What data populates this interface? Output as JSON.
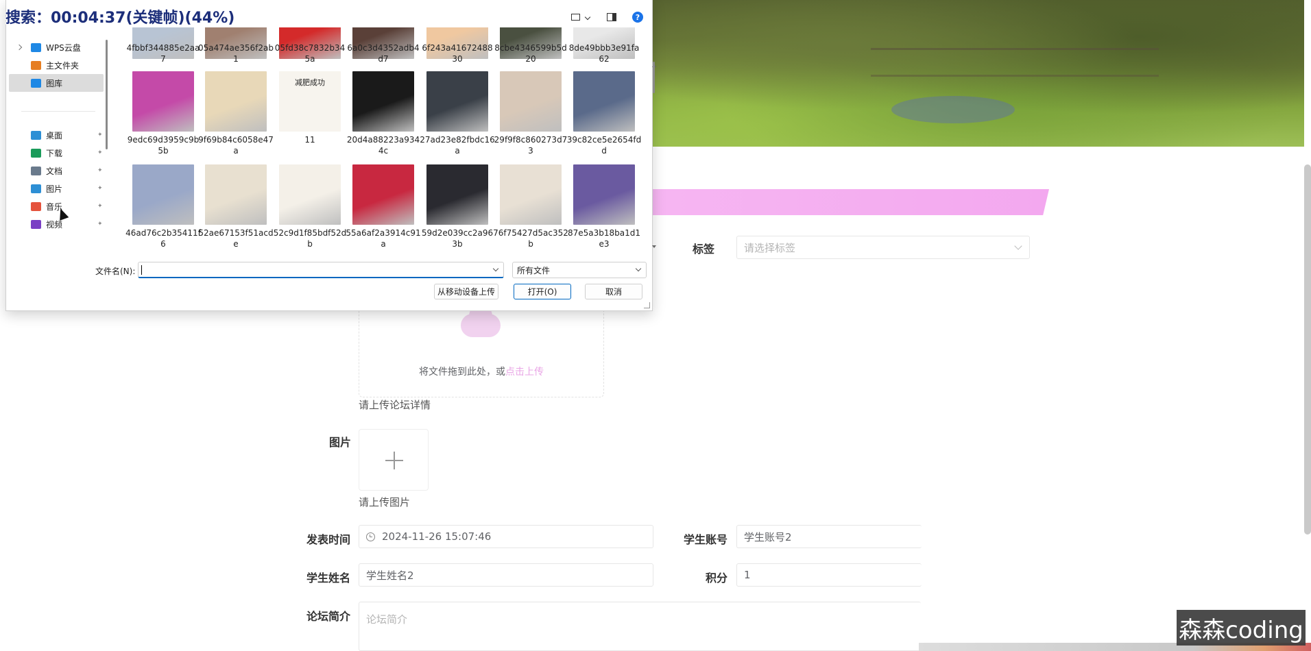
{
  "overlay": {
    "status_text": "搜索：00:04:37(关键帧)(44%)"
  },
  "form": {
    "tag_label": "标签",
    "tag_placeholder": "请选择标签",
    "upload_text": "将文件拖到此处，或",
    "upload_link": "点击上传",
    "detail_hint": "请上传论坛详情",
    "image_label": "图片",
    "image_hint": "请上传图片",
    "publish_time_label": "发表时间",
    "publish_time_value": "2024-11-26 15:07:46",
    "student_account_label": "学生账号",
    "student_account_value": "学生账号2",
    "student_name_label": "学生姓名",
    "student_name_value": "学生姓名2",
    "points_label": "积分",
    "points_value": "1",
    "intro_label": "论坛简介",
    "intro_placeholder": "论坛简介"
  },
  "watermark": {
    "text": "森森coding"
  },
  "dialog": {
    "toolbar": {
      "help_glyph": "?"
    },
    "nav": {
      "items": [
        {
          "label": "WPS云盘",
          "icon": "cloud-icon",
          "color": "#1e88e5"
        },
        {
          "label": "主文件夹",
          "icon": "home-icon",
          "color": "#e67e22"
        },
        {
          "label": "图库",
          "icon": "gallery-icon",
          "color": "#1e88e5"
        },
        {
          "label": "桌面",
          "icon": "desktop-icon",
          "color": "#2d8fd5"
        },
        {
          "label": "下载",
          "icon": "download-icon",
          "color": "#1a9b5a"
        },
        {
          "label": "文档",
          "icon": "documents-icon",
          "color": "#6a7a8c"
        },
        {
          "label": "图片",
          "icon": "pictures-icon",
          "color": "#2d8fd5"
        },
        {
          "label": "音乐",
          "icon": "music-icon",
          "color": "#e5533d"
        },
        {
          "label": "视频",
          "icon": "video-icon",
          "color": "#7a3fc4"
        }
      ]
    },
    "files": [
      {
        "name": "4fbbf344885e2aa7",
        "color": "#b8c4d4"
      },
      {
        "name": "05a474ae356f2ab1",
        "color": "#a08070"
      },
      {
        "name": "05fd38c7832b345a",
        "color": "#d42a2a"
      },
      {
        "name": "6a0c3d4352adb4d7",
        "color": "#5a4038"
      },
      {
        "name": "6f243a4167248830",
        "color": "#f0c8a0"
      },
      {
        "name": "8cbe4346599b5d20",
        "color": "#4a5040"
      },
      {
        "name": "8de49bbb3e91fa62",
        "color": "#e8e8e8"
      },
      {
        "name": "9edc69d3959c9b5b",
        "color": "#c44aa8"
      },
      {
        "name": "9f69b84c6058e47a",
        "color": "#e8d8b8"
      },
      {
        "name": "11",
        "color": "#3a3a3a"
      },
      {
        "name": "20d4a88223a9344c",
        "color": "#1a1a1a"
      },
      {
        "name": "27ad23e82fbdc16a",
        "color": "#3a4048"
      },
      {
        "name": "29f9f8c860273d73",
        "color": "#d8c8b8"
      },
      {
        "name": "39c82ce5e2654fdd",
        "color": "#5a6a8a"
      },
      {
        "name": "46ad76c2b35411f6",
        "color": "#9aa8c8"
      },
      {
        "name": "52ae67153f51acde",
        "color": "#e8e0d0"
      },
      {
        "name": "52c9d1f85bdf52db",
        "color": "#f4f0e8"
      },
      {
        "name": "55a6af2a3914c91a",
        "color": "#c82840"
      },
      {
        "name": "59d2e039cc2a963b",
        "color": "#2a2a30"
      },
      {
        "name": "76f75427d5ac352b",
        "color": "#e8e0d4"
      },
      {
        "name": "87e5a3b18ba1d1e3",
        "color": "#6a5aa0"
      }
    ],
    "thumb_text_11": "减肥成功",
    "filename_label": "文件名(N):",
    "filename_value": "",
    "filetype_value": "所有文件",
    "upload_mobile_button": "从移动设备上传",
    "open_button": "打开(O)",
    "cancel_button": "取消"
  }
}
